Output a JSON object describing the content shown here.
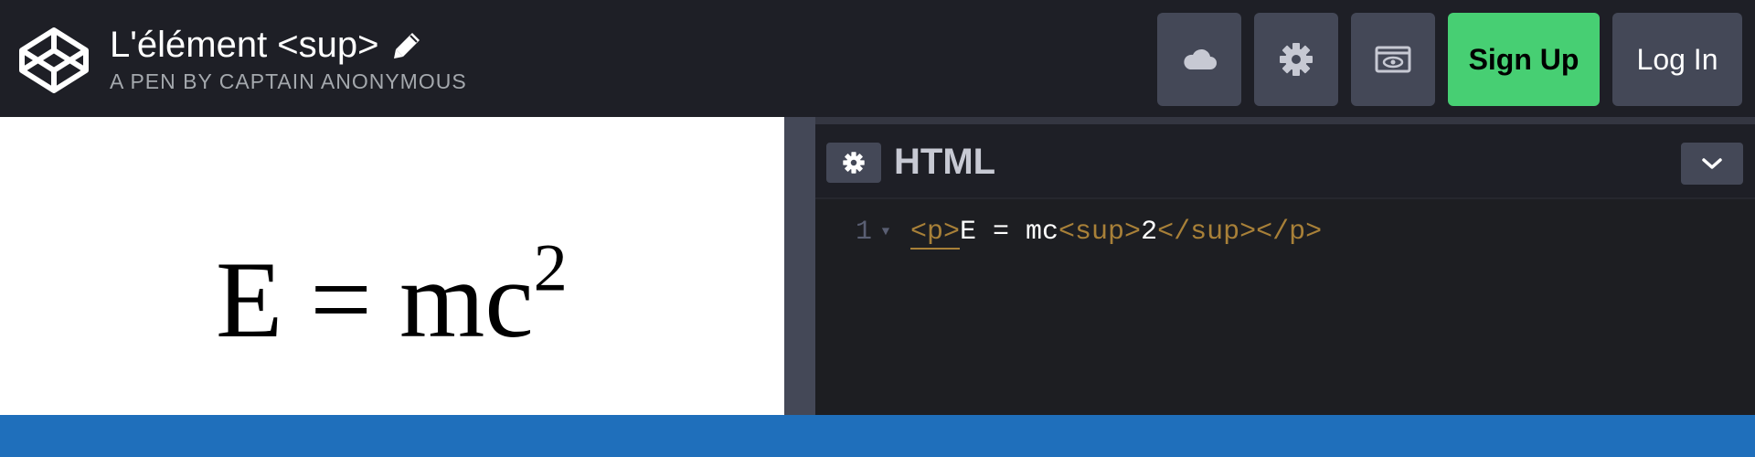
{
  "header": {
    "pen_title": "L'élément <sup>",
    "pen_author": "A Pen by Captain Anonymous",
    "signup_label": "Sign Up",
    "login_label": "Log In"
  },
  "preview": {
    "base": "E = mc",
    "superscript": "2"
  },
  "editor": {
    "title": "HTML",
    "line_number": "1",
    "code": {
      "open_p": "<p>",
      "text": "E = mc",
      "open_sup": "<sup>",
      "sup_text": "2",
      "close_sup": "</sup>",
      "close_p": "</p>"
    }
  },
  "colors": {
    "header_bg": "#1e1f26",
    "button_bg": "#444857",
    "signup_green": "#47cf73",
    "footer_blue": "#1f6fbb",
    "tag_color": "#a88038"
  },
  "icons": [
    "codepen-logo-icon",
    "pencil-icon",
    "cloud-icon",
    "gear-icon",
    "eye-icon",
    "chevron-down-icon"
  ]
}
